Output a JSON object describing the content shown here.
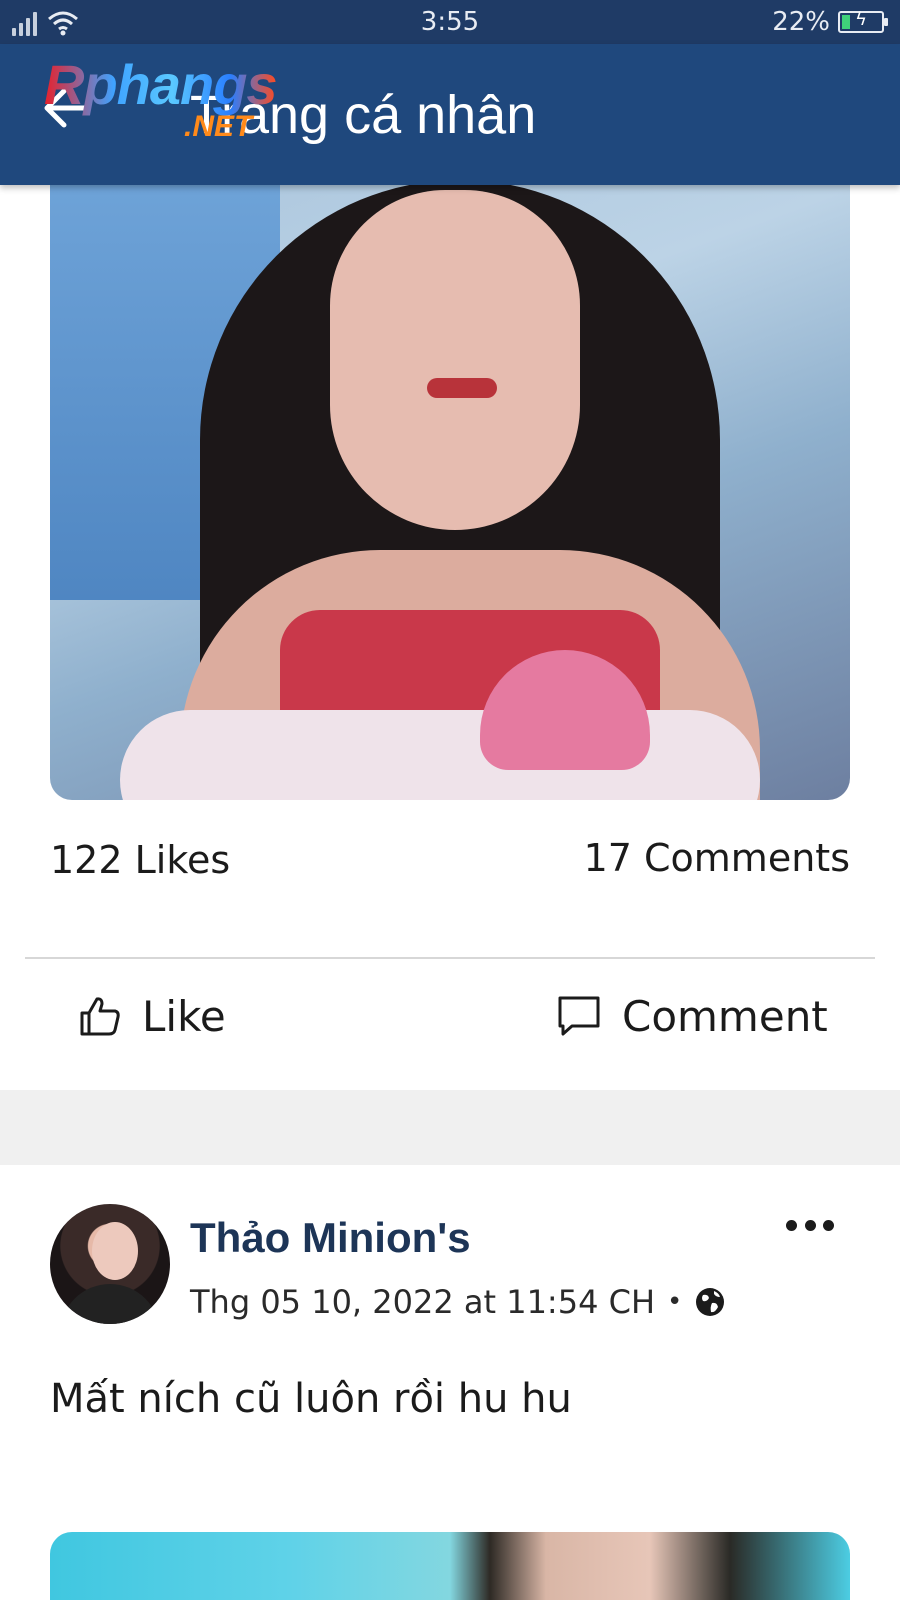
{
  "status_bar": {
    "time": "3:55",
    "battery_percent_label": "22%",
    "battery_level": 0.22,
    "battery_color": "#3fd17a"
  },
  "app_bar": {
    "title": "Trang cá nhân",
    "back_icon": "arrow-left-icon",
    "background": "#1f487d",
    "watermark": {
      "main": "Rphangs",
      "suffix": ".NET"
    }
  },
  "post": {
    "likes_text": "122 Likes",
    "comments_text": "17 Comments",
    "like_label": "Like",
    "comment_label": "Comment",
    "like_icon": "thumbs-up-icon",
    "comment_icon": "speech-bubble-icon"
  },
  "next_post": {
    "author": "Thảo Minion's",
    "date": "Thg 05 10, 2022 at 11:54 CH",
    "separator": "•",
    "privacy_icon": "globe-icon",
    "more_icon": "more-dots-icon",
    "text": "Mất ních cũ luôn rồi hu hu",
    "name_color": "#1d3557"
  }
}
